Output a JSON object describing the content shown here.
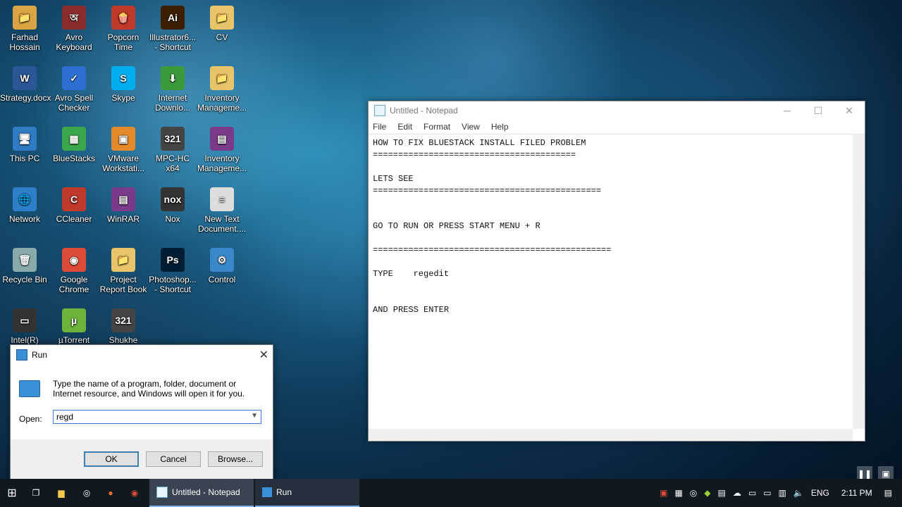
{
  "desktop": {
    "icons": [
      {
        "label": "Farhad Hossain",
        "glyph": "📁",
        "color": "#d9a441"
      },
      {
        "label": "Avro Keyboard",
        "glyph": "অ",
        "color": "#8b2c2c"
      },
      {
        "label": "Popcorn Time",
        "glyph": "🍿",
        "color": "#c0392b"
      },
      {
        "label": "Illustrator6... - Shortcut",
        "glyph": "Ai",
        "color": "#3d1f00"
      },
      {
        "label": "CV",
        "glyph": "📁",
        "color": "#e8c56a"
      },
      {
        "label": "Strategy.docx",
        "glyph": "W",
        "color": "#2b5797"
      },
      {
        "label": "Avro Spell Checker",
        "glyph": "✓",
        "color": "#2d6fd0"
      },
      {
        "label": "Skype",
        "glyph": "S",
        "color": "#00aff0"
      },
      {
        "label": "Internet Downlo...",
        "glyph": "⬇",
        "color": "#3b9a3b"
      },
      {
        "label": "Inventory Manageme...",
        "glyph": "📁",
        "color": "#e8c56a"
      },
      {
        "label": "This PC",
        "glyph": "🖥",
        "color": "#2f7cc4"
      },
      {
        "label": "BlueStacks",
        "glyph": "▦",
        "color": "#3aa84a"
      },
      {
        "label": "VMware Workstati...",
        "glyph": "▣",
        "color": "#e48a2a"
      },
      {
        "label": "MPC-HC x64",
        "glyph": "321",
        "color": "#444"
      },
      {
        "label": "Inventory Manageme...",
        "glyph": "▤",
        "color": "#7a3b8a"
      },
      {
        "label": "Network",
        "glyph": "🌐",
        "color": "#2d7fc7"
      },
      {
        "label": "CCleaner",
        "glyph": "C",
        "color": "#c0392b"
      },
      {
        "label": "WinRAR",
        "glyph": "▤",
        "color": "#7a3b8a"
      },
      {
        "label": "Nox",
        "glyph": "nox",
        "color": "#333"
      },
      {
        "label": "New Text Document....",
        "glyph": "≡",
        "color": "#ddd"
      },
      {
        "label": "Recycle Bin",
        "glyph": "🗑",
        "color": "#8aa"
      },
      {
        "label": "Google Chrome",
        "glyph": "◉",
        "color": "#dd4b39"
      },
      {
        "label": "Project Report Book",
        "glyph": "📁",
        "color": "#e8c56a"
      },
      {
        "label": "Photoshop... - Shortcut",
        "glyph": "Ps",
        "color": "#001d34"
      },
      {
        "label": "Control",
        "glyph": "⚙",
        "color": "#3a88c9"
      },
      {
        "label": "Intel(R)",
        "glyph": "▭",
        "color": "#333"
      },
      {
        "label": "µTorrent",
        "glyph": "µ",
        "color": "#6bb33a"
      },
      {
        "label": "Shukhe",
        "glyph": "321",
        "color": "#444"
      }
    ]
  },
  "notepad": {
    "title": "Untitled - Notepad",
    "menu": [
      "File",
      "Edit",
      "Format",
      "View",
      "Help"
    ],
    "controls": {
      "minimize": "─",
      "maximize": "☐",
      "close": "✕"
    },
    "content": "HOW TO FIX BLUESTACK INSTALL FILED PROBLEM\n========================================\n\nLETS SEE\n=============================================\n\n\nGO TO RUN OR PRESS START MENU + R\n\n===============================================\n\nTYPE    regedit\n\n\nAND PRESS ENTER"
  },
  "run_dialog": {
    "title": "Run",
    "description": "Type the name of a program, folder, document or Internet resource, and Windows will open it for you.",
    "open_label": "Open:",
    "input_value": "regd",
    "ok_label": "OK",
    "cancel_label": "Cancel",
    "browse_label": "Browse..."
  },
  "taskbar": {
    "tasks": [
      {
        "label": "Untitled - Notepad"
      },
      {
        "label": "Run"
      }
    ],
    "language": "ENG",
    "time": "2:11 PM"
  }
}
